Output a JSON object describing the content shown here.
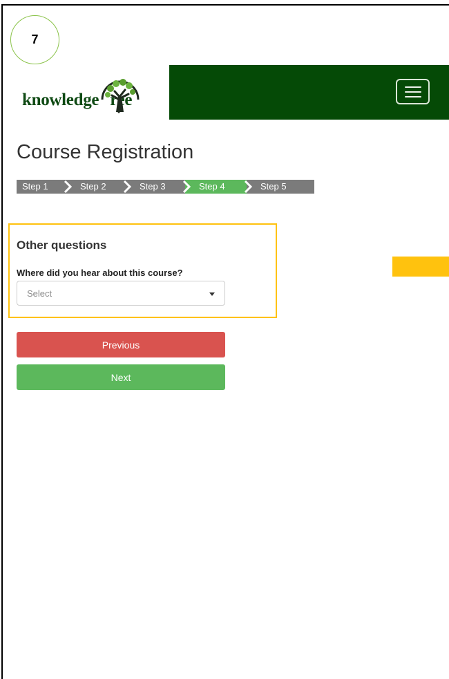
{
  "annotation": {
    "step_number": "7"
  },
  "brand": {
    "logo_text": "knowledge",
    "logo_text_suffix": "ree"
  },
  "page": {
    "title": "Course Registration"
  },
  "steps": [
    {
      "label": "Step 1",
      "active": false
    },
    {
      "label": "Step 2",
      "active": false
    },
    {
      "label": "Step 3",
      "active": false
    },
    {
      "label": "Step 4",
      "active": true
    },
    {
      "label": "Step 5",
      "active": false
    }
  ],
  "form": {
    "section_title": "Other questions",
    "field_label": "Where did you hear about this course?",
    "select_value": "Select"
  },
  "buttons": {
    "previous": "Previous",
    "next": "Next"
  },
  "colors": {
    "navbar": "#054a06",
    "step_active": "#5cb85c",
    "step_inactive": "#7b7b7b",
    "highlight": "#ffc20e",
    "previous_button": "#d9534f",
    "next_button": "#5cb85c"
  }
}
